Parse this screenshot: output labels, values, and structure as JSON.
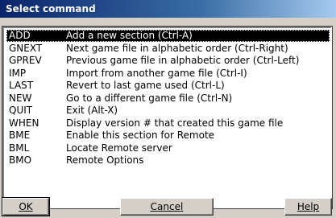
{
  "window": {
    "title": "Select command"
  },
  "commands": [
    {
      "cmd": "ADD",
      "desc": "Add a new section (Ctrl-A)"
    },
    {
      "cmd": "GNEXT",
      "desc": "Next game file in alphabetic order (Ctrl-Right)"
    },
    {
      "cmd": "GPREV",
      "desc": "Previous game file in alphabetic order (Ctrl-Left)"
    },
    {
      "cmd": "IMP",
      "desc": "Import from another game file (Ctrl-I)"
    },
    {
      "cmd": "LAST",
      "desc": "Revert to last game used (Ctrl-L)"
    },
    {
      "cmd": "NEW",
      "desc": "Go to a different game file (Ctrl-N)"
    },
    {
      "cmd": "QUIT",
      "desc": "Exit (Alt-X)"
    },
    {
      "cmd": "WHEN",
      "desc": "Display version # that created this game file"
    },
    {
      "cmd": "BME",
      "desc": "Enable this section for Remote"
    },
    {
      "cmd": "BML",
      "desc": "Locate Remote server"
    },
    {
      "cmd": "BMO",
      "desc": "Remote Options"
    }
  ],
  "selected_index": 0,
  "buttons": {
    "ok": "OK",
    "cancel": "Cancel",
    "help": "Help"
  }
}
